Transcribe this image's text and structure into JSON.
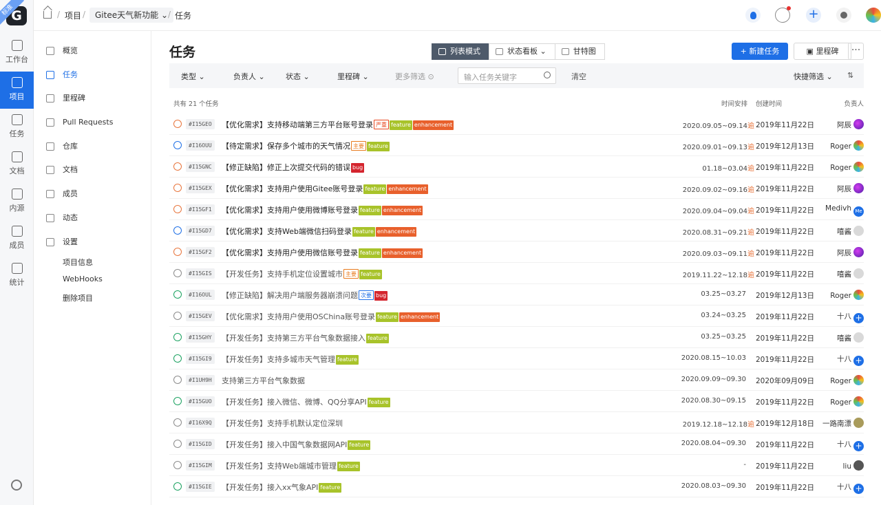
{
  "rail": {
    "logo": "G",
    "badge": "标准",
    "items": [
      {
        "label": "工作台",
        "icon": "grid-icon"
      },
      {
        "label": "项目",
        "icon": "book-icon"
      },
      {
        "label": "任务",
        "icon": "checklist-icon"
      },
      {
        "label": "文档",
        "icon": "doc-icon"
      },
      {
        "label": "内源",
        "icon": "source-icon"
      },
      {
        "label": "成员",
        "icon": "members-icon"
      },
      {
        "label": "统计",
        "icon": "chart-icon"
      }
    ]
  },
  "breadcrumb": {
    "root": "项目",
    "project": "Gitee天气新功能",
    "current": "任务"
  },
  "sidebar": {
    "items": [
      {
        "label": "概览",
        "icon": "bar-chart-icon"
      },
      {
        "label": "任务",
        "icon": "task-icon"
      },
      {
        "label": "里程碑",
        "icon": "milestone-icon"
      },
      {
        "label": "Pull Requests",
        "icon": "pull-request-icon"
      },
      {
        "label": "仓库",
        "icon": "code-icon"
      },
      {
        "label": "文档",
        "icon": "document-icon"
      },
      {
        "label": "成员",
        "icon": "members-icon"
      },
      {
        "label": "动态",
        "icon": "activity-icon"
      },
      {
        "label": "设置",
        "icon": "settings-icon"
      }
    ],
    "sub_items": [
      "项目信息",
      "WebHooks",
      "删除项目"
    ]
  },
  "main": {
    "title": "任务",
    "views": [
      "列表模式",
      "状态看板",
      "甘特图"
    ],
    "new_task": "新建任务",
    "milestone": "里程碑",
    "more": "···",
    "filters": {
      "type": "类型",
      "assignee": "负责人",
      "status": "状态",
      "milestone": "里程碑",
      "more": "更多筛选",
      "search_placeholder": "输入任务关键字",
      "clear": "清空",
      "quick": "快捷筛选"
    },
    "list_header": {
      "count": "共有 21 个任务",
      "schedule": "时间安排",
      "created": "创建时间",
      "assignee": "负责人"
    },
    "late_mark": "逾",
    "tasks": [
      {
        "status": "open",
        "id": "#I15GEO",
        "title": "【优化需求】支持移动端第三方平台账号登录",
        "tags": [
          {
            "t": "严重",
            "c": "severe"
          },
          {
            "t": "feature",
            "c": "feature"
          },
          {
            "t": "enhancement",
            "c": "enhancement"
          }
        ],
        "schedule": "2020.09.05~09.14",
        "late": true,
        "created": "2019年11月22日",
        "assignee": "阿辰",
        "avatar": "purple"
      },
      {
        "status": "doing",
        "id": "#I16OUU",
        "title": "【待定需求】保存多个城市的天气情况",
        "tags": [
          {
            "t": "主要",
            "c": "major"
          },
          {
            "t": "feature",
            "c": "feature"
          }
        ],
        "schedule": "2020.09.01~09.13",
        "late": true,
        "created": "2019年12月13日",
        "assignee": "Roger",
        "avatar": "colorful"
      },
      {
        "status": "open",
        "id": "#I15GNC",
        "title": "【修正缺陷】修正上次提交代码的错误",
        "tags": [
          {
            "t": "bug",
            "c": "bug"
          }
        ],
        "schedule": "01.18~03.04",
        "late": true,
        "created": "2019年11月22日",
        "assignee": "Roger",
        "avatar": "colorful"
      },
      {
        "status": "open",
        "id": "#I15GEX",
        "title": "【优化需求】支持用户使用Gitee账号登录",
        "tags": [
          {
            "t": "feature",
            "c": "feature"
          },
          {
            "t": "enhancement",
            "c": "enhancement"
          }
        ],
        "schedule": "2020.09.02~09.16",
        "late": true,
        "created": "2019年11月22日",
        "assignee": "阿辰",
        "avatar": "purple"
      },
      {
        "status": "open",
        "id": "#I15GF1",
        "title": "【优化需求】支持用户使用微博账号登录",
        "tags": [
          {
            "t": "feature",
            "c": "feature"
          },
          {
            "t": "enhancement",
            "c": "enhancement"
          }
        ],
        "schedule": "2020.09.04~09.04",
        "late": true,
        "created": "2019年11月22日",
        "assignee": "Medivh",
        "avatar": "blue",
        "avatar_text": "Me"
      },
      {
        "status": "doing",
        "id": "#I15GD7",
        "title": "【优化需求】支持Web端微信扫码登录",
        "tags": [
          {
            "t": "feature",
            "c": "feature"
          },
          {
            "t": "enhancement",
            "c": "enhancement"
          }
        ],
        "schedule": "2020.08.31~09.21",
        "late": true,
        "created": "2019年11月22日",
        "assignee": "嘻酱",
        "avatar": "gray"
      },
      {
        "status": "open",
        "id": "#I15GF2",
        "title": "【优化需求】支持用户使用微信账号登录",
        "tags": [
          {
            "t": "feature",
            "c": "feature"
          },
          {
            "t": "enhancement",
            "c": "enhancement"
          }
        ],
        "schedule": "2020.09.03~09.11",
        "late": true,
        "created": "2019年11月22日",
        "assignee": "阿辰",
        "avatar": "purple"
      },
      {
        "status": "closed",
        "id": "#I15GIS",
        "title": "【开发任务】支持手机定位设置城市",
        "tags": [
          {
            "t": "主要",
            "c": "major"
          },
          {
            "t": "feature",
            "c": "feature"
          }
        ],
        "schedule": "2019.11.22~12.18",
        "late": true,
        "created": "2019年11月22日",
        "assignee": "嘻酱",
        "avatar": "gray"
      },
      {
        "status": "done",
        "id": "#I16OUL",
        "title": "【修正缺陷】解决用户端服务器崩溃问题",
        "tags": [
          {
            "t": "次要",
            "c": "minor"
          },
          {
            "t": "bug",
            "c": "bug"
          }
        ],
        "schedule": "03.25~03.27",
        "late": false,
        "created": "2019年12月13日",
        "assignee": "Roger",
        "avatar": "colorful"
      },
      {
        "status": "closed",
        "id": "#I15GEV",
        "title": "【优化需求】支持用户使用OSChina账号登录",
        "tags": [
          {
            "t": "feature",
            "c": "feature"
          },
          {
            "t": "enhancement",
            "c": "enhancement"
          }
        ],
        "schedule": "03.24~03.25",
        "late": false,
        "created": "2019年11月22日",
        "assignee": "十八",
        "avatar": "plus"
      },
      {
        "status": "done",
        "id": "#I15GHY",
        "title": "【开发任务】支持第三方平台气象数据接入",
        "tags": [
          {
            "t": "feature",
            "c": "feature"
          }
        ],
        "schedule": "03.25~03.25",
        "late": false,
        "created": "2019年11月22日",
        "assignee": "嘻酱",
        "avatar": "gray"
      },
      {
        "status": "done",
        "id": "#I15GI9",
        "title": "【开发任务】支持多城市天气管理",
        "tags": [
          {
            "t": "feature",
            "c": "feature"
          }
        ],
        "schedule": "2020.08.15~10.03",
        "late": false,
        "created": "2019年11月22日",
        "assignee": "十八",
        "avatar": "plus"
      },
      {
        "status": "closed",
        "id": "#I1UH9H",
        "title": "支持第三方平台气象数据",
        "tags": [],
        "schedule": "2020.09.09~09.30",
        "late": false,
        "created": "2020年09月09日",
        "assignee": "Roger",
        "avatar": "colorful"
      },
      {
        "status": "done",
        "id": "#I15GUO",
        "title": "【开发任务】接入微信、微博、QQ分享API",
        "tags": [
          {
            "t": "feature",
            "c": "feature"
          }
        ],
        "schedule": "2020.08.30~09.15",
        "late": false,
        "created": "2019年11月22日",
        "assignee": "Roger",
        "avatar": "colorful"
      },
      {
        "status": "closed",
        "id": "#I16X9Q",
        "title": "【开发任务】支持手机默认定位深圳",
        "tags": [],
        "schedule": "2019.12.18~12.18",
        "late": true,
        "created": "2019年12月18日",
        "assignee": "一路南漂",
        "avatar": "olive"
      },
      {
        "status": "closed",
        "id": "#I15GID",
        "title": "【开发任务】接入中国气象数据网API",
        "tags": [
          {
            "t": "feature",
            "c": "feature"
          }
        ],
        "schedule": "2020.08.04~09.30",
        "late": false,
        "created": "2019年11月22日",
        "assignee": "十八",
        "avatar": "plus"
      },
      {
        "status": "closed",
        "id": "#I15GIM",
        "title": "【开发任务】支持Web端城市管理",
        "tags": [
          {
            "t": "feature",
            "c": "feature"
          }
        ],
        "schedule": "-",
        "late": false,
        "created": "2019年11月22日",
        "assignee": "liu",
        "avatar": "dark"
      },
      {
        "status": "done",
        "id": "#I15GIE",
        "title": "【开发任务】接入xx气象API",
        "tags": [
          {
            "t": "feature",
            "c": "feature"
          }
        ],
        "schedule": "2020.08.03~09.30",
        "late": false,
        "created": "2019年11月22日",
        "assignee": "十八",
        "avatar": "plus"
      }
    ]
  }
}
